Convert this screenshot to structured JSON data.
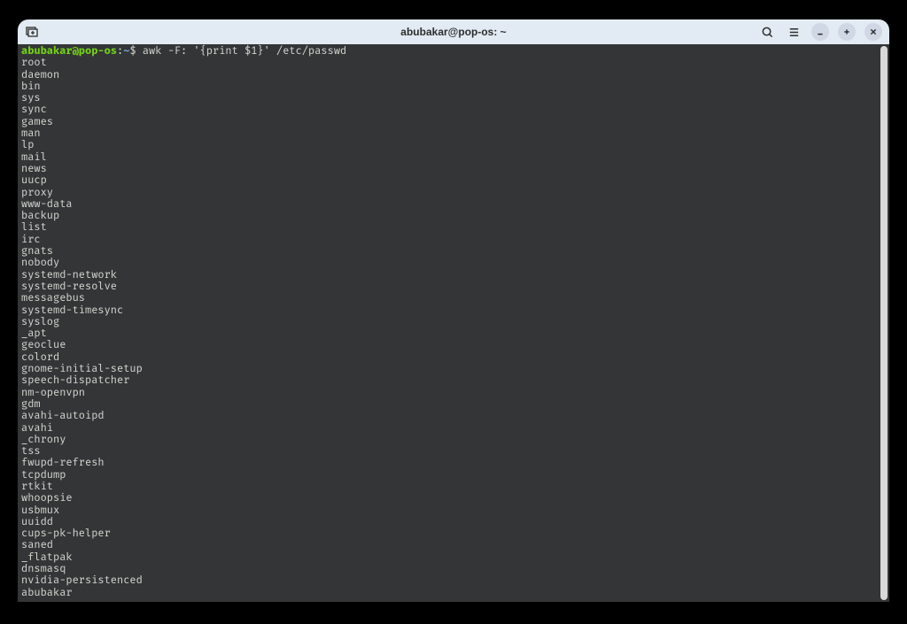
{
  "window": {
    "title": "abubakar@pop-os: ~"
  },
  "prompt": {
    "user_host": "abubakar@pop-os",
    "separator": ":",
    "path": "~",
    "symbol": "$"
  },
  "command": "awk -F: '{print $1}' /etc/passwd",
  "output": [
    "root",
    "daemon",
    "bin",
    "sys",
    "sync",
    "games",
    "man",
    "lp",
    "mail",
    "news",
    "uucp",
    "proxy",
    "www-data",
    "backup",
    "list",
    "irc",
    "gnats",
    "nobody",
    "systemd-network",
    "systemd-resolve",
    "messagebus",
    "systemd-timesync",
    "syslog",
    "_apt",
    "geoclue",
    "colord",
    "gnome-initial-setup",
    "speech-dispatcher",
    "nm-openvpn",
    "gdm",
    "avahi-autoipd",
    "avahi",
    "_chrony",
    "tss",
    "fwupd-refresh",
    "tcpdump",
    "rtkit",
    "whoopsie",
    "usbmux",
    "uuidd",
    "cups-pk-helper",
    "saned",
    "_flatpak",
    "dnsmasq",
    "nvidia-persistenced",
    "abubakar"
  ],
  "titlebar": {
    "new_tab_icon": "new-tab",
    "search_icon": "search",
    "menu_icon": "menu",
    "minimize_icon": "minimize",
    "maximize_icon": "maximize",
    "close_icon": "close"
  }
}
